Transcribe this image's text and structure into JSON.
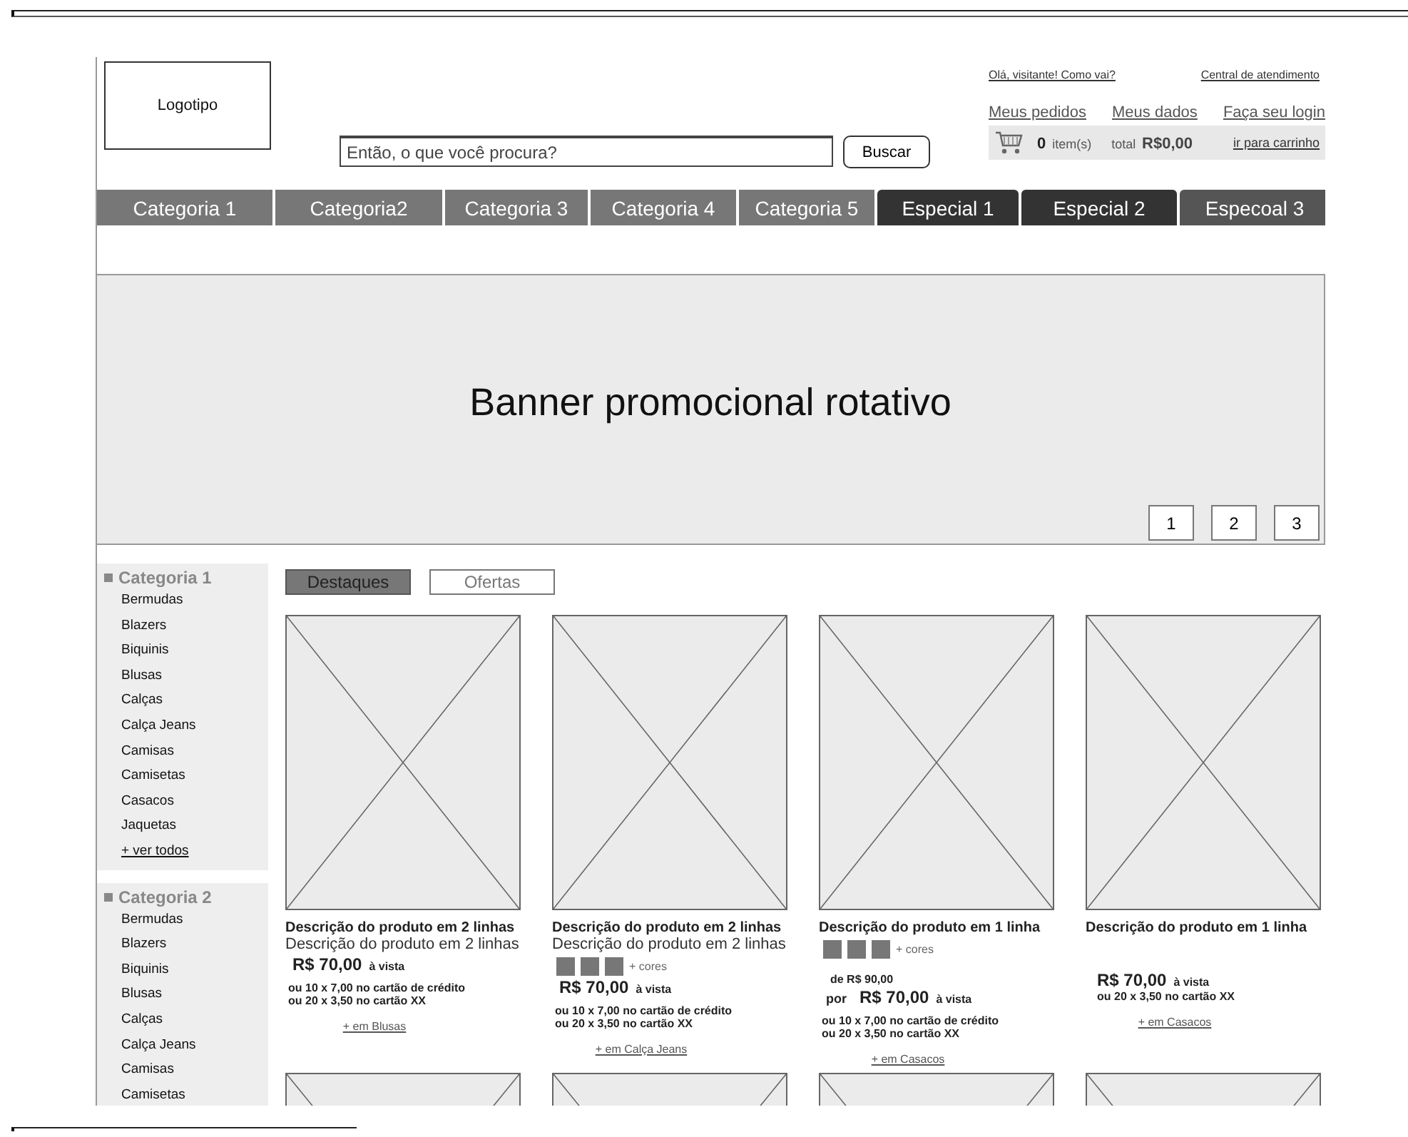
{
  "header": {
    "logo": "Logotipo",
    "search": {
      "placeholder": "Então, o que você procura?",
      "button": "Buscar"
    },
    "top_links": [
      "Olá, visitante! Como vai?",
      "Central de atendimento"
    ],
    "account_links": [
      "Meus pedidos",
      "Meus dados",
      "Faça seu login"
    ],
    "cart": {
      "count": "0",
      "count_label": "item(s)",
      "total_label": "total",
      "total": "R$0,00",
      "link": "ir para carrinho"
    }
  },
  "nav": [
    {
      "label": "Categoria 1",
      "kind": "category"
    },
    {
      "label": "Categoria2",
      "kind": "category"
    },
    {
      "label": "Categoria 3",
      "kind": "category"
    },
    {
      "label": "Categoria 4",
      "kind": "category"
    },
    {
      "label": "Categoria 5",
      "kind": "category"
    },
    {
      "label": "Especial 1",
      "kind": "special"
    },
    {
      "label": "Especial 2",
      "kind": "special"
    },
    {
      "label": "Especoal 3",
      "kind": "special-light"
    }
  ],
  "banner": {
    "text": "Banner promocional rotativo",
    "pages": [
      "1",
      "2",
      "3"
    ]
  },
  "sidebar": [
    {
      "title": "Categoria 1",
      "items": [
        "Bermudas",
        "Blazers",
        "Biquinis",
        "Blusas",
        "Calças",
        "Calça Jeans",
        "Camisas",
        "Camisetas",
        "Casacos",
        "Jaquetas"
      ],
      "more": "+ ver todos"
    },
    {
      "title": "Categoria 2",
      "items": [
        "Bermudas",
        "Blazers",
        "Biquinis",
        "Blusas",
        "Calças",
        "Calça Jeans",
        "Camisas",
        "Camisetas"
      ]
    }
  ],
  "tabs": [
    {
      "label": "Destaques",
      "selected": true
    },
    {
      "label": "Ofertas",
      "selected": false
    }
  ],
  "products": [
    {
      "title": "Descrição do produto em 2 linhas",
      "subtitle": "Descrição do produto em 2 linhas",
      "price": "R$ 70,00",
      "price_note": "à vista",
      "installments": [
        "ou 10 x 7,00 no cartão de crédito",
        "ou 20 x 3,50 no cartão XX"
      ],
      "link": "+ em Blusas"
    },
    {
      "title": "Descrição do produto em 2 linhas",
      "subtitle": "Descrição do produto em 2 linhas",
      "swatches": [
        {
          "kind": "square"
        },
        {
          "kind": "square"
        },
        {
          "kind": "square"
        }
      ],
      "more_colors": "+ cores",
      "price": "R$ 70,00",
      "price_note": "à vista",
      "installments": [
        "ou 10 x 7,00 no cartão de crédito",
        "ou 20 x 3,50 no cartão XX"
      ],
      "link": "+ em Calça Jeans"
    },
    {
      "title": "Descrição do produto em 1 linha",
      "swatches": [
        {
          "kind": "square"
        },
        {
          "kind": "square"
        },
        {
          "kind": "square"
        }
      ],
      "more_colors": "+ cores",
      "old_price": "de R$ 90,00",
      "price_prefix": "por",
      "price": "R$ 70,00",
      "price_note": "à vista",
      "installments": [
        "ou 10 x 7,00 no cartão de crédito",
        "ou 20 x 3,50 no cartão XX"
      ],
      "link": "+ em Casacos"
    },
    {
      "title": "Descrição do produto em 1 linha",
      "price": "R$ 70,00",
      "price_note": "à vista",
      "installments": [
        "ou 20 x 3,50 no cartão XX"
      ],
      "link": "+ em Casacos"
    }
  ],
  "next_row": [
    {
      "kind": "image"
    },
    {
      "kind": "image"
    },
    {
      "kind": "image"
    },
    {
      "kind": "image"
    }
  ]
}
